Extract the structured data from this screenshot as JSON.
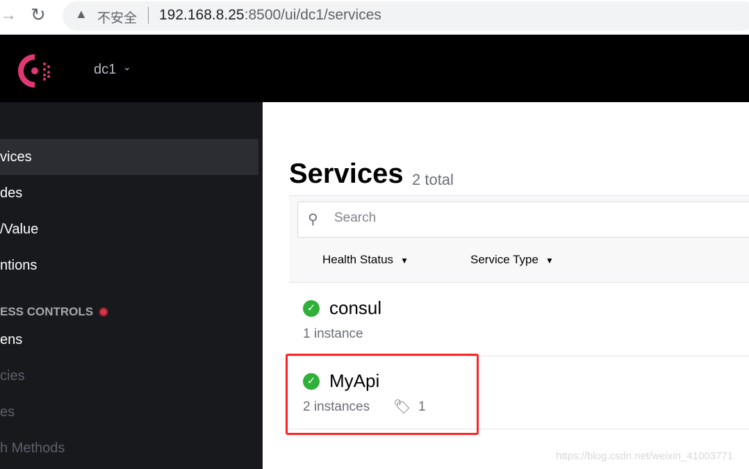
{
  "browser": {
    "insecure_label": "不安全",
    "url_host": "192.168.8.25",
    "url_rest": ":8500/ui/dc1/services"
  },
  "header": {
    "datacenter": "dc1"
  },
  "sidebar": {
    "items": [
      {
        "label": "vices",
        "active": true
      },
      {
        "label": "des"
      },
      {
        "label": "/Value"
      },
      {
        "label": "ntions"
      }
    ],
    "acl_heading": "ESS CONTROLS",
    "acl_items": [
      {
        "label": "ens"
      },
      {
        "label": "cies"
      },
      {
        "label": "es"
      },
      {
        "label": "h Methods"
      }
    ]
  },
  "main": {
    "title": "Services",
    "total": "2 total",
    "search_placeholder": "Search",
    "filters": [
      "Health Status",
      "Service Type"
    ],
    "services": [
      {
        "name": "consul",
        "health": "passing",
        "instances": "1 instance"
      },
      {
        "name": "MyApi",
        "health": "passing",
        "instances": "2 instances",
        "tags": "1"
      }
    ]
  },
  "watermark": "https://blog.csdn.net/weixin_41003771",
  "colors": {
    "brand": "#e03875",
    "passing": "#2eb039",
    "highlight": "#ff2222"
  }
}
